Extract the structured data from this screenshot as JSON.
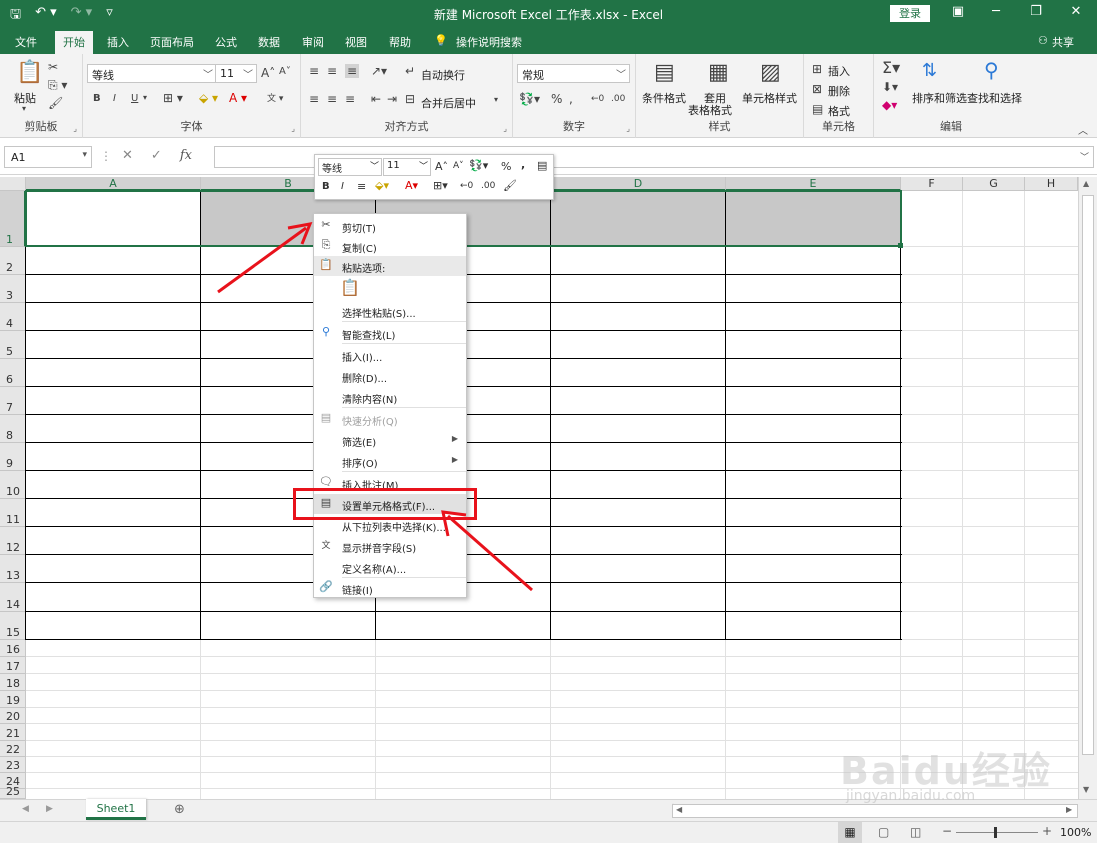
{
  "titlebar": {
    "title": "新建 Microsoft Excel 工作表.xlsx - Excel",
    "login": "登录",
    "save_icon": "save-icon",
    "undo_icon": "undo-icon",
    "redo_icon": "redo-icon"
  },
  "tabs": [
    "文件",
    "开始",
    "插入",
    "页面布局",
    "公式",
    "数据",
    "审阅",
    "视图",
    "帮助"
  ],
  "tell_me": "操作说明搜索",
  "share": "共享",
  "ribbon": {
    "clipboard": {
      "paste": "粘贴",
      "label": "剪贴板"
    },
    "font": {
      "name": "等线",
      "size": "11",
      "bold": "B",
      "italic": "I",
      "underline": "U",
      "label": "字体"
    },
    "alignment": {
      "wrap": "自动换行",
      "merge": "合并后居中",
      "label": "对齐方式"
    },
    "number": {
      "format": "常规",
      "label": "数字"
    },
    "styles": {
      "conditional": "条件格式",
      "table_format_1": "套用",
      "table_format_2": "表格格式",
      "cell_styles": "单元格样式",
      "label": "样式"
    },
    "cells": {
      "insert": "插入",
      "delete": "删除",
      "format": "格式",
      "label": "单元格"
    },
    "editing": {
      "sort": "排序和筛选",
      "find": "查找和选择",
      "label": "编辑"
    }
  },
  "formula_bar": {
    "name_box": "A1",
    "fx": "fx"
  },
  "columns": [
    "A",
    "B",
    "C",
    "D",
    "E",
    "F",
    "G",
    "H"
  ],
  "rows": [
    "1",
    "2",
    "3",
    "4",
    "5",
    "6",
    "7",
    "8",
    "9",
    "10",
    "11",
    "12",
    "13",
    "14",
    "15",
    "16",
    "17",
    "18",
    "19",
    "20",
    "21",
    "22",
    "23",
    "24",
    "25"
  ],
  "mini_toolbar": {
    "font": "等线",
    "size": "11",
    "bold": "B",
    "italic": "I"
  },
  "context_menu": [
    {
      "label": "剪切(T)",
      "icon": "scissors-icon"
    },
    {
      "label": "复制(C)",
      "icon": "copy-icon"
    },
    {
      "label": "粘贴选项:",
      "icon": "paste-icon"
    },
    {
      "label": "选择性粘贴(S)...",
      "icon": ""
    },
    {
      "label": "智能查找(L)",
      "icon": "smart-lookup-icon"
    },
    {
      "label": "插入(I)...",
      "icon": ""
    },
    {
      "label": "删除(D)...",
      "icon": ""
    },
    {
      "label": "清除内容(N)",
      "icon": ""
    },
    {
      "label": "快速分析(Q)",
      "icon": "quick-analysis-icon"
    },
    {
      "label": "筛选(E)",
      "icon": ""
    },
    {
      "label": "排序(O)",
      "icon": ""
    },
    {
      "label": "插入批注(M)",
      "icon": "comment-icon"
    },
    {
      "label": "设置单元格格式(F)...",
      "icon": "format-cells-icon"
    },
    {
      "label": "从下拉列表中选择(K)...",
      "icon": ""
    },
    {
      "label": "显示拼音字段(S)",
      "icon": "phonetic-icon"
    },
    {
      "label": "定义名称(A)...",
      "icon": ""
    },
    {
      "label": "链接(I)",
      "icon": "link-icon"
    }
  ],
  "sheet_tabs": [
    "Sheet1"
  ],
  "status": {
    "zoom": "100%"
  },
  "watermark": {
    "line1": "Baidu经验",
    "line2": "jingyan.baidu.com"
  },
  "colors": {
    "accent": "#217346",
    "annotation": "#e8121b"
  }
}
